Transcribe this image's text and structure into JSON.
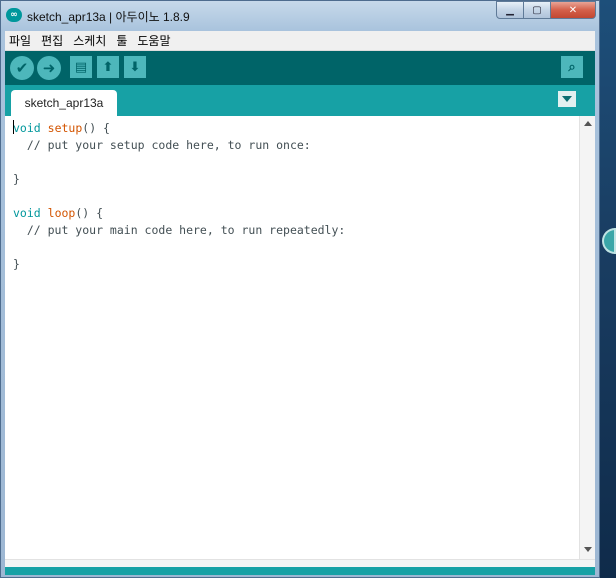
{
  "window": {
    "title": "sketch_apr13a | 아두이노 1.8.9",
    "app_icon": "arduino-logo-icon",
    "controls": {
      "minimize_icon": "minimize-icon",
      "maximize_icon": "maximize-icon",
      "close_icon": "close-icon"
    }
  },
  "menubar": {
    "items": [
      "파일",
      "편집",
      "스케치",
      "툴",
      "도움말"
    ]
  },
  "toolbar": {
    "buttons": [
      {
        "name": "verify",
        "icon": "checkmark-icon",
        "glyph": "✔"
      },
      {
        "name": "upload",
        "icon": "arrow-right-icon",
        "glyph": "➜"
      },
      {
        "name": "new",
        "icon": "new-file-icon",
        "glyph": "▤"
      },
      {
        "name": "open",
        "icon": "arrow-up-icon",
        "glyph": "⬆"
      },
      {
        "name": "save",
        "icon": "arrow-down-icon",
        "glyph": "⬇"
      }
    ],
    "serial_monitor_icon": "magnifier-icon",
    "serial_monitor_glyph": "⌕"
  },
  "tabs": [
    {
      "label": "sketch_apr13a",
      "active": true
    }
  ],
  "tab_menu_icon": "triangle-down-icon",
  "editor": {
    "lines": [
      [
        {
          "t": "void",
          "c": "kw"
        },
        {
          "t": " ",
          "c": ""
        },
        {
          "t": "setup",
          "c": "fn"
        },
        {
          "t": "() {",
          "c": ""
        }
      ],
      [
        {
          "t": "  // put your setup code here, to run once:",
          "c": "cm"
        }
      ],
      [
        {
          "t": "",
          "c": ""
        }
      ],
      [
        {
          "t": "}",
          "c": ""
        }
      ],
      [
        {
          "t": "",
          "c": ""
        }
      ],
      [
        {
          "t": "void",
          "c": "kw"
        },
        {
          "t": " ",
          "c": ""
        },
        {
          "t": "loop",
          "c": "fn"
        },
        {
          "t": "() {",
          "c": ""
        }
      ],
      [
        {
          "t": "  // put your main code here, to run repeatedly:",
          "c": "cm"
        }
      ],
      [
        {
          "t": "",
          "c": ""
        }
      ],
      [
        {
          "t": "}",
          "c": ""
        }
      ]
    ]
  },
  "colors": {
    "toolbar": "#006468",
    "tabbar": "#17a1a5",
    "button": "#4db7bb",
    "keyword": "#00979c",
    "function": "#d35400",
    "text": "#434f54"
  }
}
